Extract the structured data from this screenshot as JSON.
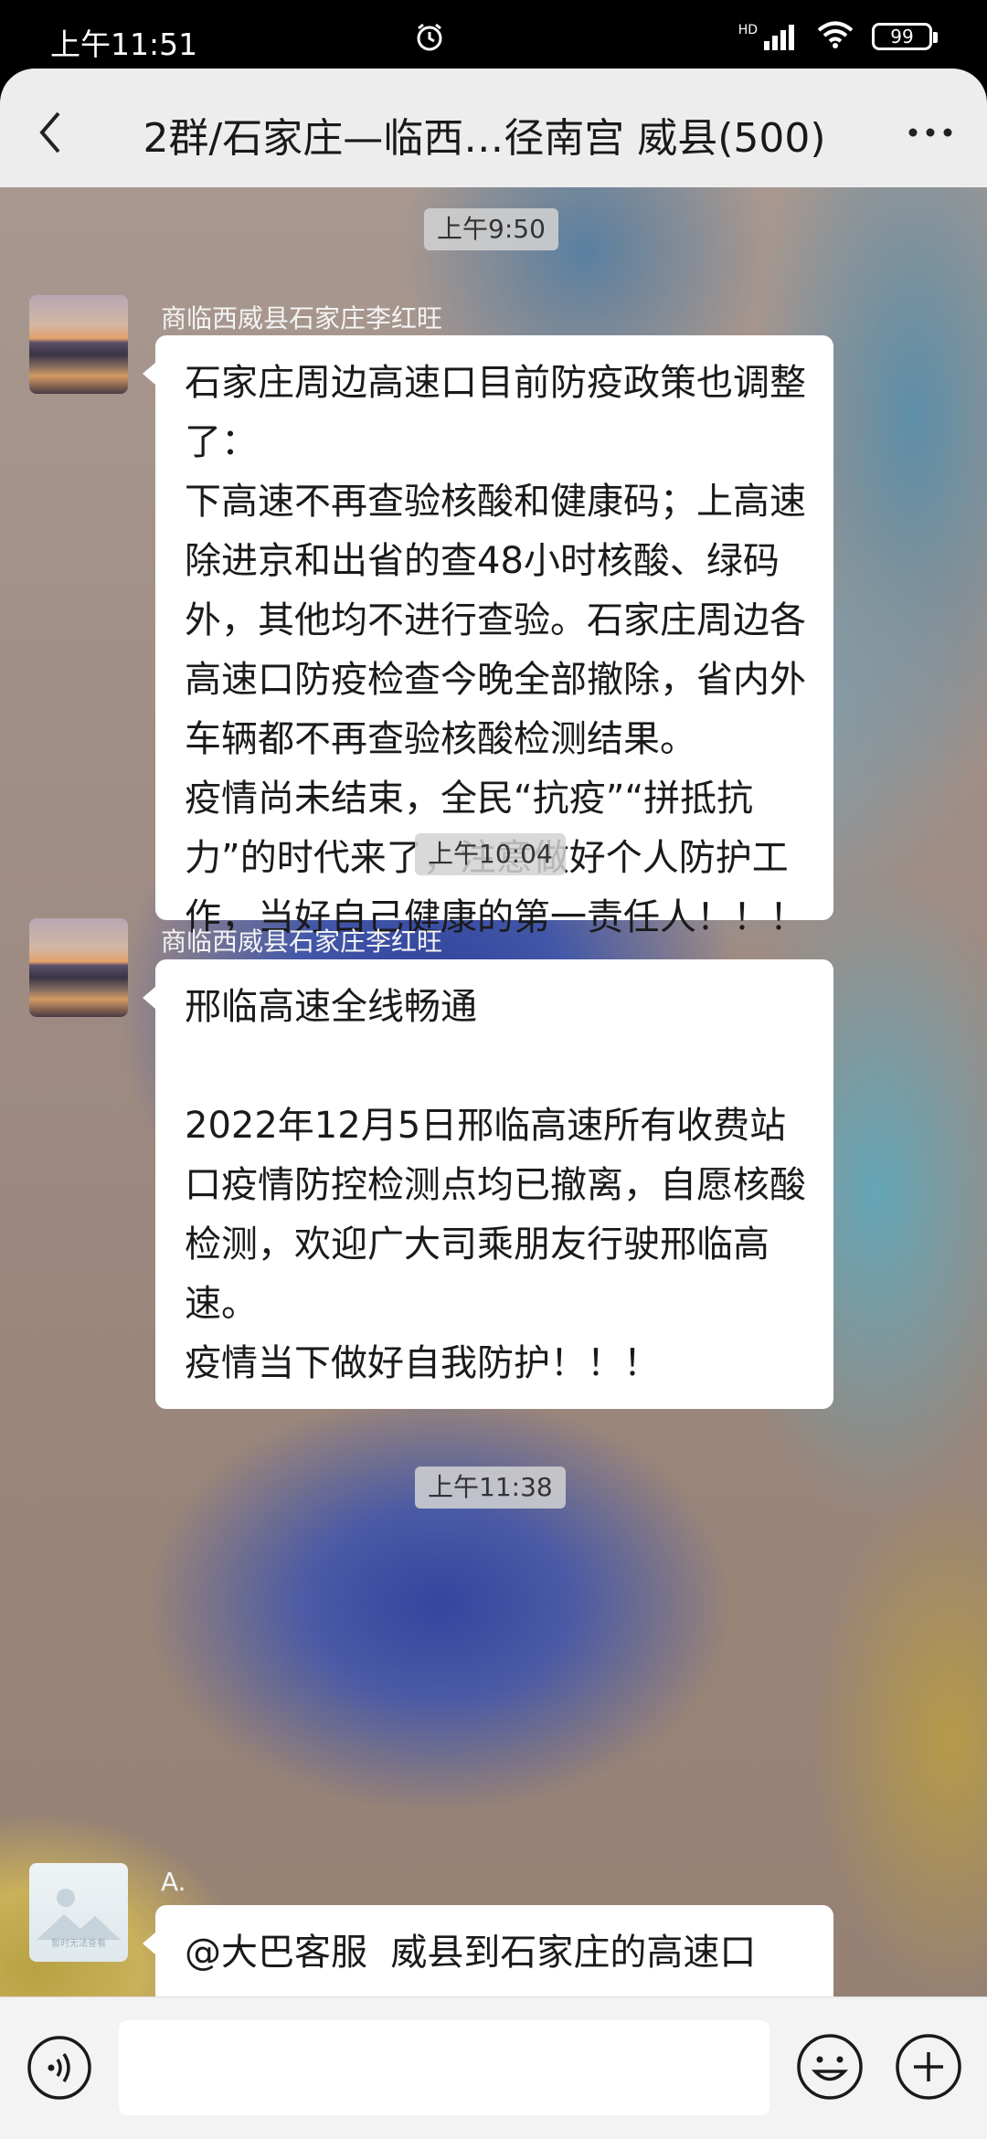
{
  "status_bar": {
    "time": "上午11:51",
    "network": "HD",
    "battery": "99"
  },
  "header": {
    "title": "2群/石家庄—临西…径南宫  威县(500)"
  },
  "messages": [
    {
      "time_label": "上午9:50",
      "sender": "商临西威县石家庄李红旺",
      "text": "石家庄周边高速口目前防疫政策也调整了：\n下高速不再查验核酸和健康码；上高速除进京和出省的查48小时核酸、绿码外，其他均不进行查验。石家庄周边各高速口防疫检查今晚全部撤除，省内外车辆都不再查验核酸检测结果。\n疫情尚未结束，全民“抗疫”“拼抵抗力”的时代来了，注意做好个人防护工作，当好自己健康的第一责任人！！！"
    },
    {
      "time_label": "上午10:04",
      "sender": "商临西威县石家庄李红旺",
      "text": "邢临高速全线畅通\n\n2022年12月5日邢临高速所有收费站口疫情防控检测点均已撤离，自愿核酸检测，欢迎广大司乘朋友行驶邢临高速。\n疫情当下做好自我防护！！！"
    },
    {
      "time_label": "上午11:38",
      "sender": "A.",
      "avatar_caption": "暂时无法查看",
      "text": "@大巴客服  威县到石家庄的高速口"
    }
  ],
  "input_bar": {
    "placeholder": ""
  },
  "colors": {
    "bubble": "#ffffff",
    "header_bg": "#ededed",
    "input_bar_bg": "#f3f3f3"
  }
}
